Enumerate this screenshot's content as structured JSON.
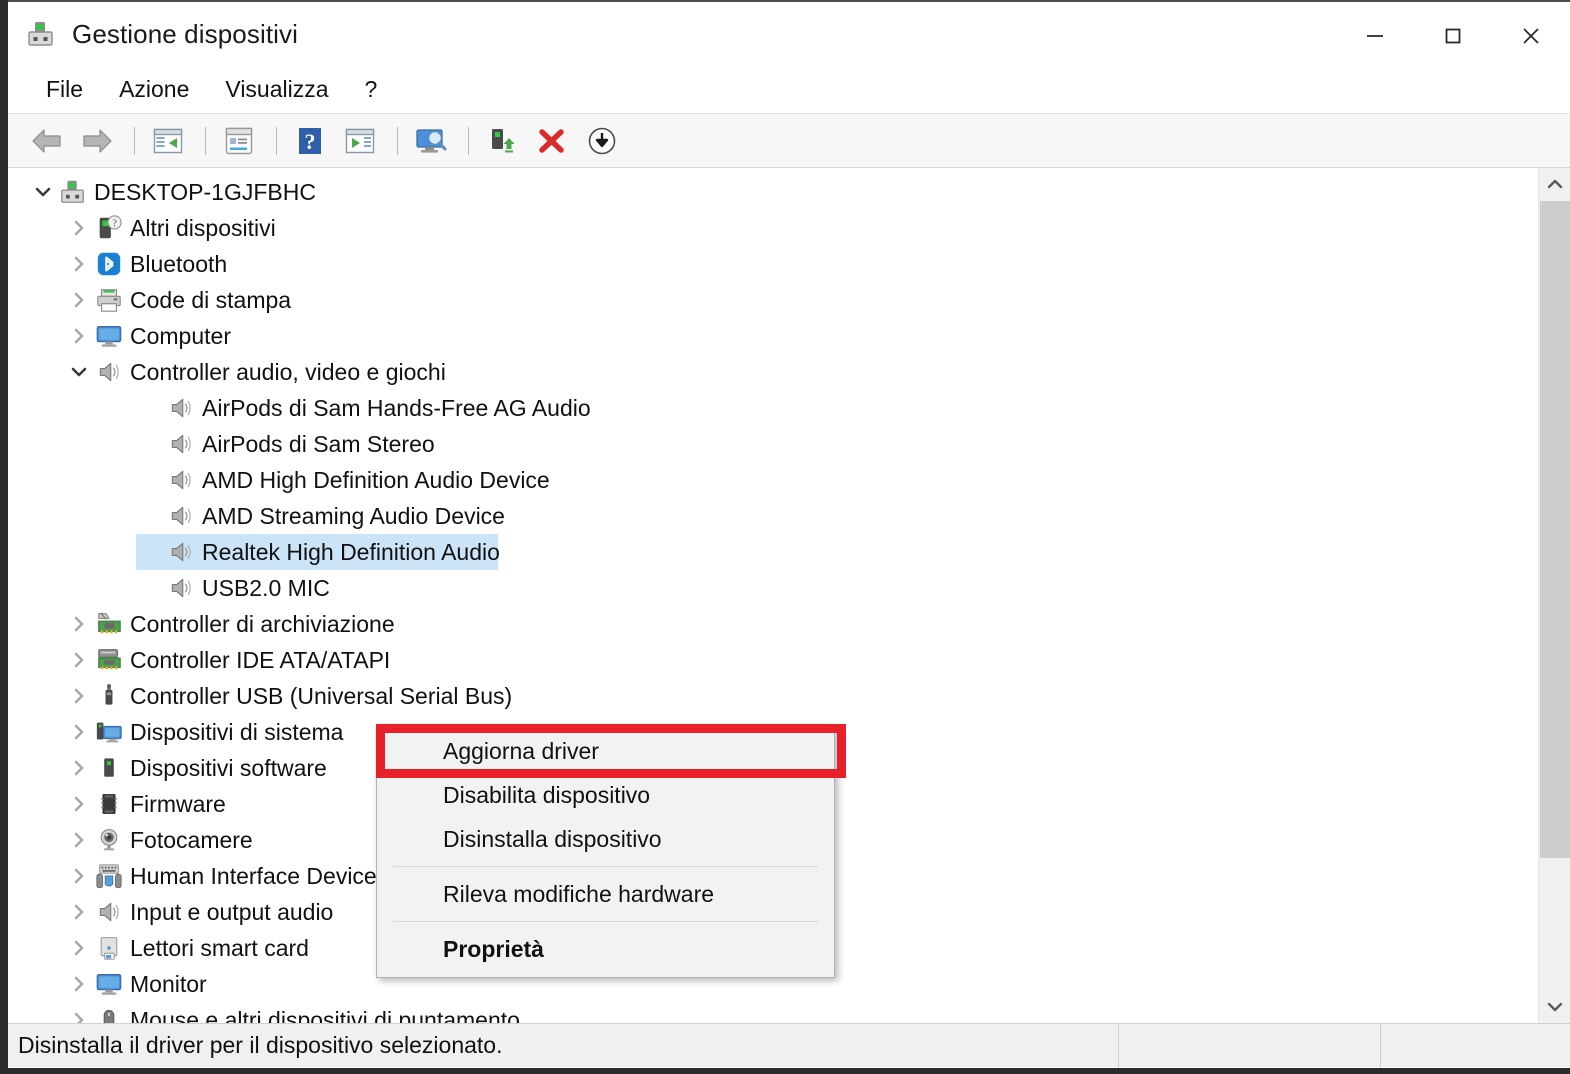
{
  "window": {
    "title": "Gestione dispositivi",
    "icon": "device-manager-icon",
    "minimize_label": "–",
    "maximize_label": "□",
    "close_label": "✕"
  },
  "menubar": {
    "items": [
      {
        "label": "File",
        "name": "menu-file"
      },
      {
        "label": "Azione",
        "name": "menu-azione"
      },
      {
        "label": "Visualizza",
        "name": "menu-visualizza"
      },
      {
        "label": "?",
        "name": "menu-help"
      }
    ]
  },
  "toolbar": {
    "buttons": [
      {
        "icon": "back-arrow-icon",
        "tooltip": "Indietro"
      },
      {
        "icon": "forward-arrow-icon",
        "tooltip": "Avanti"
      },
      {
        "icon": "show-hide-console-tree-icon",
        "tooltip": "Mostra/Nascondi struttura ad albero"
      },
      {
        "icon": "properties-icon",
        "tooltip": "Proprietà"
      },
      {
        "icon": "help-icon",
        "tooltip": "Guida"
      },
      {
        "icon": "update-driver-icon",
        "tooltip": "Aggiorna driver"
      },
      {
        "icon": "scan-hardware-changes-icon",
        "tooltip": "Rileva modifiche hardware"
      },
      {
        "icon": "enable-device-icon",
        "tooltip": "Abilita dispositivo"
      },
      {
        "icon": "uninstall-device-icon",
        "tooltip": "Disinstalla dispositivo"
      },
      {
        "icon": "disable-device-icon",
        "tooltip": "Disabilita dispositivo"
      }
    ]
  },
  "tree": {
    "rows": [
      {
        "label": "DESKTOP-1GJFBHC",
        "depth": 0,
        "state": "expanded",
        "icon": "computer-root-icon",
        "selected": false
      },
      {
        "label": "Altri dispositivi",
        "depth": 1,
        "state": "collapsed",
        "icon": "unknown-device-icon",
        "selected": false
      },
      {
        "label": "Bluetooth",
        "depth": 1,
        "state": "collapsed",
        "icon": "bluetooth-icon",
        "selected": false
      },
      {
        "label": "Code di stampa",
        "depth": 1,
        "state": "collapsed",
        "icon": "printer-icon",
        "selected": false
      },
      {
        "label": "Computer",
        "depth": 1,
        "state": "collapsed",
        "icon": "monitor-icon",
        "selected": false
      },
      {
        "label": "Controller audio, video e giochi",
        "depth": 1,
        "state": "expanded",
        "icon": "speaker-icon",
        "selected": false
      },
      {
        "label": "AirPods di Sam Hands-Free AG Audio",
        "depth": 2,
        "state": "leaf",
        "icon": "speaker-icon",
        "selected": false
      },
      {
        "label": "AirPods di Sam Stereo",
        "depth": 2,
        "state": "leaf",
        "icon": "speaker-icon",
        "selected": false
      },
      {
        "label": "AMD High Definition Audio Device",
        "depth": 2,
        "state": "leaf",
        "icon": "speaker-icon",
        "selected": false
      },
      {
        "label": "AMD Streaming Audio Device",
        "depth": 2,
        "state": "leaf",
        "icon": "speaker-icon",
        "selected": false
      },
      {
        "label": "Realtek High Definition Audio",
        "depth": 2,
        "state": "leaf",
        "icon": "speaker-icon",
        "selected": true
      },
      {
        "label": "USB2.0 MIC",
        "depth": 2,
        "state": "leaf",
        "icon": "speaker-icon",
        "selected": false
      },
      {
        "label": "Controller di archiviazione",
        "depth": 1,
        "state": "collapsed",
        "icon": "storage-controller-icon",
        "selected": false
      },
      {
        "label": "Controller IDE ATA/ATAPI",
        "depth": 1,
        "state": "collapsed",
        "icon": "ide-controller-icon",
        "selected": false
      },
      {
        "label": "Controller USB (Universal Serial Bus)",
        "depth": 1,
        "state": "collapsed",
        "icon": "usb-icon",
        "selected": false
      },
      {
        "label": "Dispositivi di sistema",
        "depth": 1,
        "state": "collapsed",
        "icon": "system-device-icon",
        "selected": false
      },
      {
        "label": "Dispositivi software",
        "depth": 1,
        "state": "collapsed",
        "icon": "software-device-icon",
        "selected": false
      },
      {
        "label": "Firmware",
        "depth": 1,
        "state": "collapsed",
        "icon": "firmware-chip-icon",
        "selected": false
      },
      {
        "label": "Fotocamere",
        "depth": 1,
        "state": "collapsed",
        "icon": "camera-icon",
        "selected": false
      },
      {
        "label": "Human Interface Device (HID)",
        "depth": 1,
        "state": "collapsed",
        "icon": "hid-keyboard-icon",
        "selected": false
      },
      {
        "label": "Input e output audio",
        "depth": 1,
        "state": "collapsed",
        "icon": "speaker-icon",
        "selected": false
      },
      {
        "label": "Lettori smart card",
        "depth": 1,
        "state": "collapsed",
        "icon": "smartcard-reader-icon",
        "selected": false
      },
      {
        "label": "Monitor",
        "depth": 1,
        "state": "collapsed",
        "icon": "monitor-icon",
        "selected": false
      },
      {
        "label": "Mouse e altri dispositivi di puntamento",
        "depth": 1,
        "state": "collapsed",
        "icon": "mouse-icon",
        "selected": false
      }
    ]
  },
  "context_menu": {
    "items": [
      {
        "label": "Aggiorna driver",
        "bold": false,
        "highlighted": true,
        "separator_after": false
      },
      {
        "label": "Disabilita dispositivo",
        "bold": false,
        "highlighted": false,
        "separator_after": false
      },
      {
        "label": "Disinstalla dispositivo",
        "bold": false,
        "highlighted": false,
        "separator_after": true
      },
      {
        "label": "Rileva modifiche hardware",
        "bold": false,
        "highlighted": false,
        "separator_after": true
      },
      {
        "label": "Proprietà",
        "bold": true,
        "highlighted": false,
        "separator_after": false
      }
    ]
  },
  "statusbar": {
    "text": "Disinstalla il driver per il dispositivo selezionato."
  },
  "colors": {
    "selection_blue": "#cce4f7",
    "annotation_red": "#e8202a",
    "menu_bg": "#f2f2f2",
    "toolbar_bg": "#f7f7f7",
    "accent_orange": "#e8820c"
  }
}
